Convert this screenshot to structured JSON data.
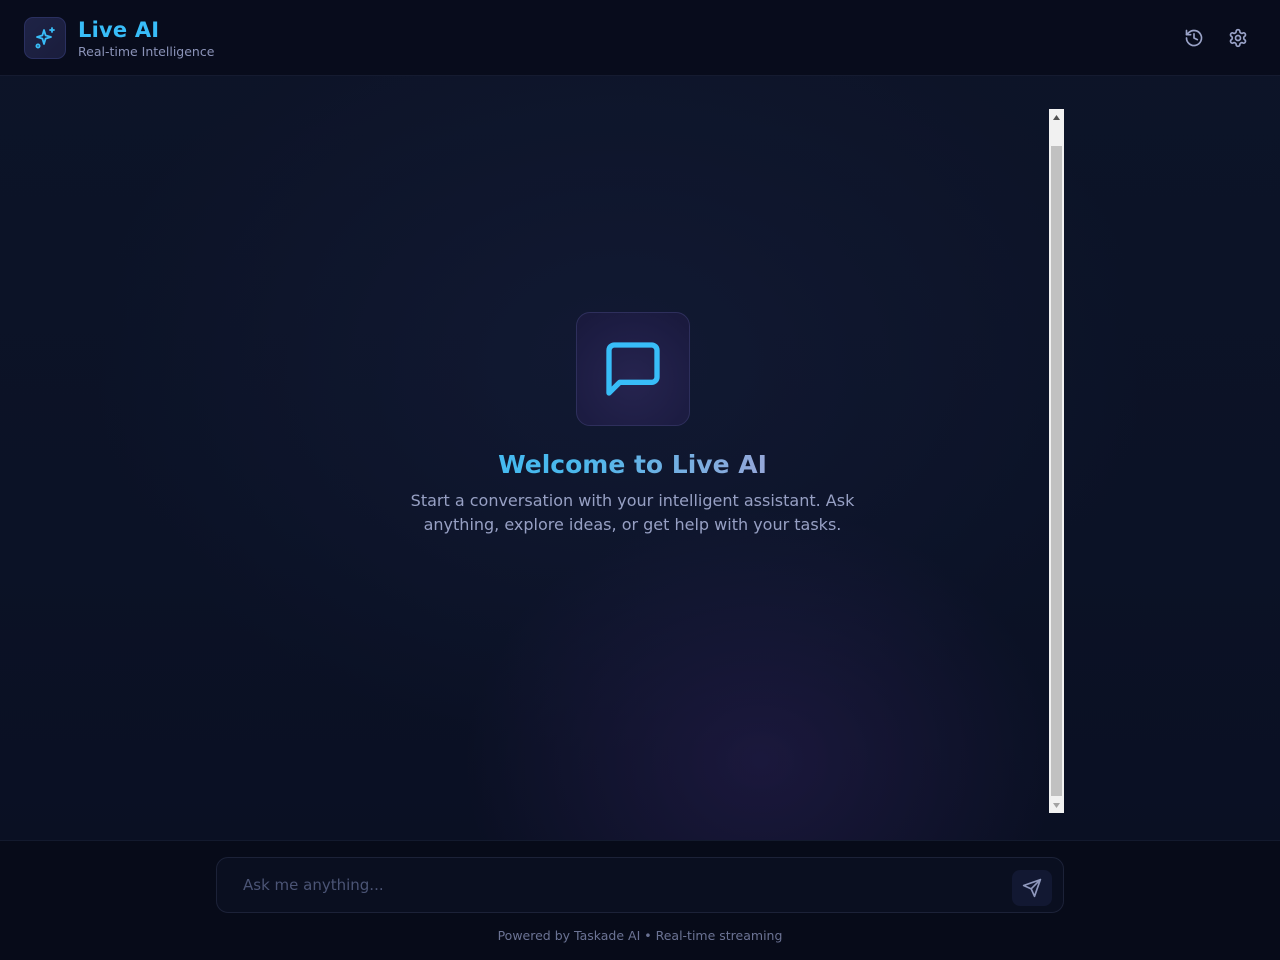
{
  "header": {
    "title": "Live AI",
    "subtitle": "Real-time Intelligence",
    "logo_icon": "sparkles-icon",
    "history_icon": "history-icon",
    "settings_icon": "gear-icon"
  },
  "welcome": {
    "icon": "message-square-icon",
    "title": "Welcome to Live AI",
    "description": "Start a conversation with your intelligent assistant. Ask anything, explore ideas, or get help with your tasks."
  },
  "composer": {
    "placeholder": "Ask me anything...",
    "value": "",
    "send_icon": "send-icon"
  },
  "footer": {
    "powered_text": "Powered by Taskade AI • Real-time streaming"
  },
  "colors": {
    "accent": "#38bdf8",
    "secondary_accent": "#a5b4fc",
    "background": "#0b1020",
    "muted_text": "#8b93b8"
  }
}
